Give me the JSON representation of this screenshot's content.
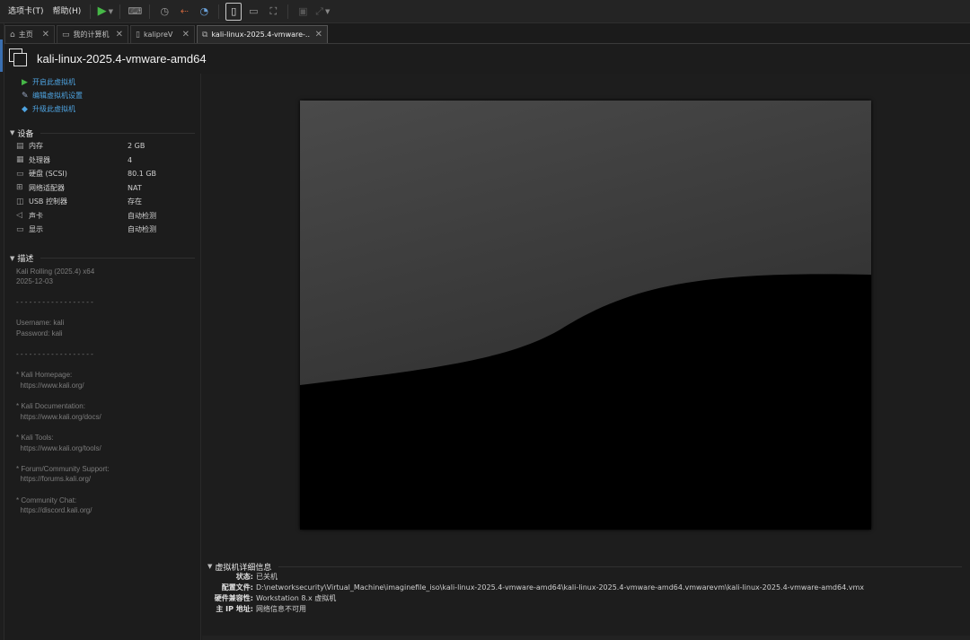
{
  "menubar": {
    "items": [
      "选项卡(T)",
      "帮助(H)"
    ]
  },
  "tabs": [
    {
      "label": "主页",
      "icon": "home-icon",
      "active": false
    },
    {
      "label": "我的计算机",
      "icon": "monitor-icon",
      "active": false
    },
    {
      "label": "kalipreV",
      "icon": "document-icon",
      "active": false
    },
    {
      "label": "kali-linux-2025.4-vmware-...",
      "icon": "vm-icon",
      "active": true
    }
  ],
  "vm": {
    "title": "kali-linux-2025.4-vmware-amd64"
  },
  "actions": [
    {
      "label": "开启此虚拟机",
      "icon": "play-icon"
    },
    {
      "label": "编辑虚拟机设置",
      "icon": "edit-settings-icon"
    },
    {
      "label": "升级此虚拟机",
      "icon": "upgrade-icon"
    }
  ],
  "devices": {
    "heading": "设备",
    "items": [
      {
        "name": "内存",
        "value": "2 GB",
        "icon": "memory-icon"
      },
      {
        "name": "处理器",
        "value": "4",
        "icon": "cpu-icon"
      },
      {
        "name": "硬盘 (SCSI)",
        "value": "80.1 GB",
        "icon": "harddisk-icon"
      },
      {
        "name": "网络适配器",
        "value": "NAT",
        "icon": "network-adapter-icon"
      },
      {
        "name": "USB 控制器",
        "value": "存在",
        "icon": "usb-icon"
      },
      {
        "name": "声卡",
        "value": "自动检测",
        "icon": "speaker-icon"
      },
      {
        "name": "显示",
        "value": "自动检测",
        "icon": "display-icon"
      }
    ]
  },
  "description": {
    "heading": "描述",
    "text": "Kali Rolling (2025.4) x64\n2025-12-03\n\n- - - - - - - - - - - - - - - - - -\n\nUsername: kali\nPassword: kali\n\n- - - - - - - - - - - - - - - - - -\n\n* Kali Homepage:\n  https://www.kali.org/\n\n* Kali Documentation:\n  https://www.kali.org/docs/\n\n* Kali Tools:\n  https://www.kali.org/tools/\n\n* Forum/Community Support:\n  https://forums.kali.org/\n\n* Community Chat:\n  https://discord.kali.org/"
  },
  "details": {
    "heading": "虚拟机详细信息",
    "rows": [
      {
        "label": "状态:",
        "value": "已关机"
      },
      {
        "label": "配置文件:",
        "value": "D:\\networksecurity\\Virtual_Machine\\imaginefile_iso\\kali-linux-2025.4-vmware-amd64\\kali-linux-2025.4-vmware-amd64.vmwarevm\\kali-linux-2025.4-vmware-amd64.vmx"
      },
      {
        "label": "硬件兼容性:",
        "value": "Workstation 8.x 虚拟机"
      },
      {
        "label": "主 IP 地址:",
        "value": "网络信息不可用"
      }
    ]
  },
  "colors": {
    "link": "#4ea3e0",
    "play": "#46b847",
    "background": "#1c1c1c"
  }
}
